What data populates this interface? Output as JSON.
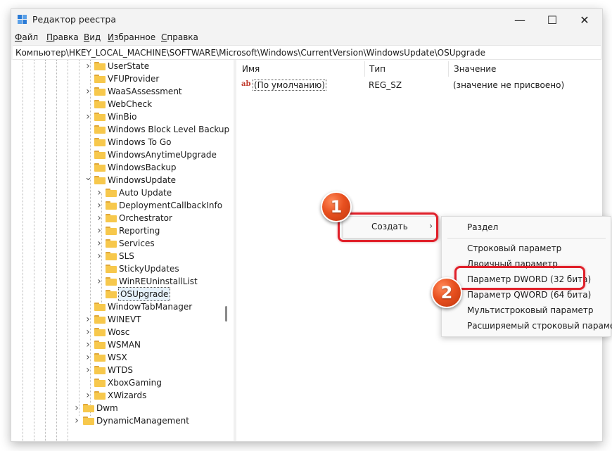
{
  "window": {
    "title": "Редактор реестра",
    "minimize_icon": "—",
    "maximize_icon": "☐",
    "close_icon": "✕"
  },
  "menu": [
    {
      "first": "Ф",
      "rest": "айл"
    },
    {
      "first": "П",
      "rest": "равка"
    },
    {
      "first": "В",
      "rest": "ид"
    },
    {
      "first": "И",
      "rest": "збранное"
    },
    {
      "first": "С",
      "rest": "правка"
    }
  ],
  "address": "Компьютер\\HKEY_LOCAL_MACHINE\\SOFTWARE\\Microsoft\\Windows\\CurrentVersion\\WindowsUpdate\\OSUpgrade",
  "tree": [
    {
      "label": "UserState",
      "exp": ">"
    },
    {
      "label": "VFUProvider",
      "exp": ""
    },
    {
      "label": "WaaSAssessment",
      "exp": ">"
    },
    {
      "label": "WebCheck",
      "exp": ""
    },
    {
      "label": "WinBio",
      "exp": ">"
    },
    {
      "label": "Windows Block Level Backup",
      "exp": ""
    },
    {
      "label": "Windows To Go",
      "exp": ""
    },
    {
      "label": "WindowsAnytimeUpgrade",
      "exp": ""
    },
    {
      "label": "WindowsBackup",
      "exp": ""
    },
    {
      "label": "WindowsUpdate",
      "exp": "v"
    },
    {
      "label": "Auto Update",
      "exp": ">"
    },
    {
      "label": "DeploymentCallbackInfo",
      "exp": ">"
    },
    {
      "label": "Orchestrator",
      "exp": ">"
    },
    {
      "label": "Reporting",
      "exp": ">"
    },
    {
      "label": "Services",
      "exp": ">"
    },
    {
      "label": "SLS",
      "exp": ">"
    },
    {
      "label": "StickyUpdates",
      "exp": ""
    },
    {
      "label": "WinREUninstallList",
      "exp": ">"
    },
    {
      "label": "OSUpgrade",
      "exp": ""
    },
    {
      "label": "WindowTabManager",
      "exp": ""
    },
    {
      "label": "WINEVT",
      "exp": ">"
    },
    {
      "label": "Wosc",
      "exp": ">"
    },
    {
      "label": "WSMAN",
      "exp": ">"
    },
    {
      "label": "WSX",
      "exp": ">"
    },
    {
      "label": "WTDS",
      "exp": ">"
    },
    {
      "label": "XboxGaming",
      "exp": ""
    },
    {
      "label": "XWizards",
      "exp": ">"
    },
    {
      "label": "Dwm",
      "exp": ">"
    },
    {
      "label": "DynamicManagement",
      "exp": ">"
    }
  ],
  "list": {
    "headers": {
      "name": "Имя",
      "type": "Тип",
      "value": "Значение"
    },
    "row": {
      "icon": "ab",
      "name": "(По умолчанию)",
      "type": "REG_SZ",
      "value": "(значение не присвоено)"
    }
  },
  "context": {
    "create_label": "Создать",
    "create_arrow": "›",
    "items": [
      "Раздел",
      "Строковый параметр",
      "Двоичный параметр",
      "Параметр DWORD (32 бита)",
      "Параметр QWORD (64 бита)",
      "Мультистроковый параметр",
      "Расширяемый строковый парамет"
    ]
  },
  "badges": [
    "1",
    "2"
  ],
  "colors": {
    "highlight": "#e0202a",
    "badge": "#e8501f",
    "folder": "#f7c84c",
    "accent": "#2b7bd6"
  }
}
